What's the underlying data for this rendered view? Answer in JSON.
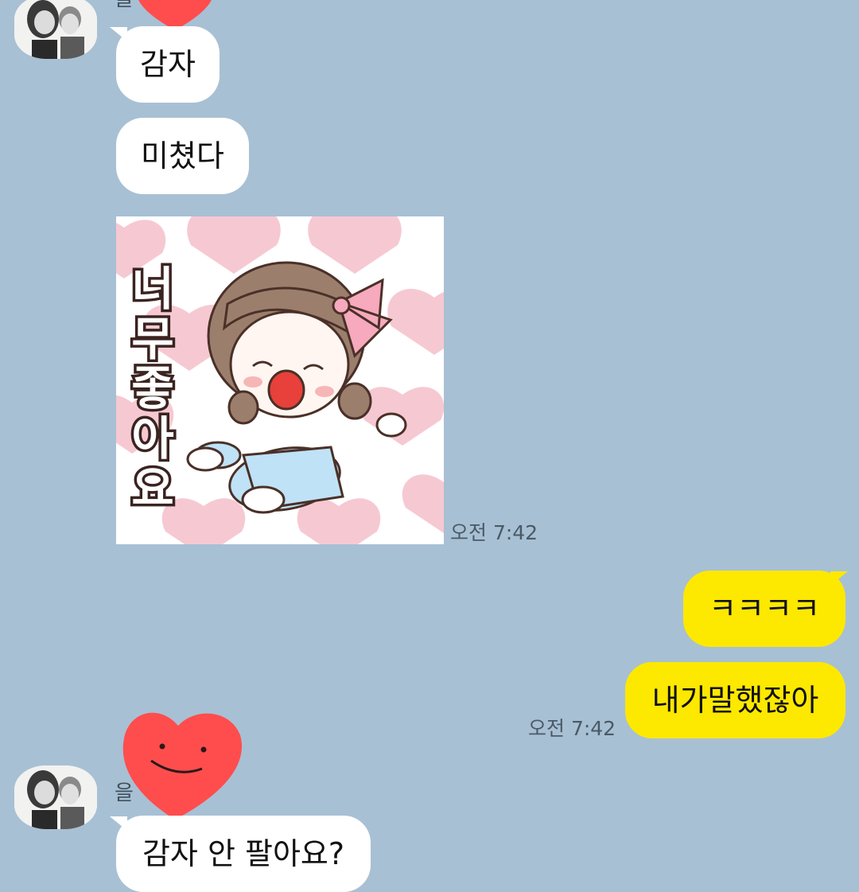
{
  "messages": {
    "incoming_1": "감자",
    "incoming_2": "미쳤다",
    "outgoing_1": "ㅋㅋㅋㅋ",
    "outgoing_2": "내가말했잖아",
    "incoming_3": "감자 안 팔아요?"
  },
  "sticker": {
    "text": "너무 좋아요",
    "colors": {
      "hearts": "#f6c9d2",
      "bg": "#ffffff",
      "dress": "#bfe2f6",
      "bow": "#f7a9bd",
      "hair": "#9b7f6c"
    }
  },
  "timestamps": {
    "sticker_time": "오전 7:42",
    "outgoing_time": "오전 7:42"
  },
  "sender": {
    "name_top": "을",
    "name_bottom": "을"
  },
  "colors": {
    "background": "#a8c0d4",
    "incoming_bubble": "#ffffff",
    "outgoing_bubble": "#fde800",
    "privacy_sticker": "#ff4d4d"
  }
}
